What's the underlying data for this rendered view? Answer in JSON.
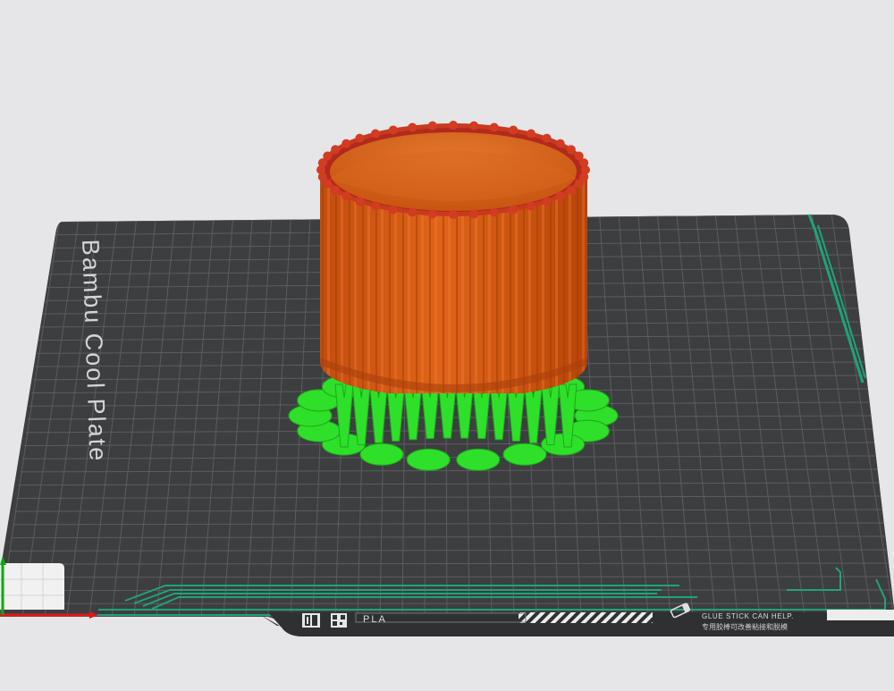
{
  "scene": {
    "plate_name": "Bambu Cool Plate",
    "filament_label": "PLA",
    "glue_hint_line1": "GLUE STICK CAN HELP.",
    "glue_hint_line2": "专用胶棒可改善粘接和脱模"
  },
  "icons": {
    "plate_logo": "bambu-logo-icon",
    "qr": "qr-code-icon",
    "glue": "glue-stick-icon",
    "axis_x": "x-axis-arrow-icon",
    "axis_y": "y-axis-arrow-icon"
  },
  "colors": {
    "background": "#e6e6e8",
    "plate": "#3d3e40",
    "grid": "#5c5d60",
    "accent_green": "#1fa37a",
    "model_orange": "#d95b14",
    "model_rim": "#b8261b",
    "support_green": "#2ee02a"
  }
}
